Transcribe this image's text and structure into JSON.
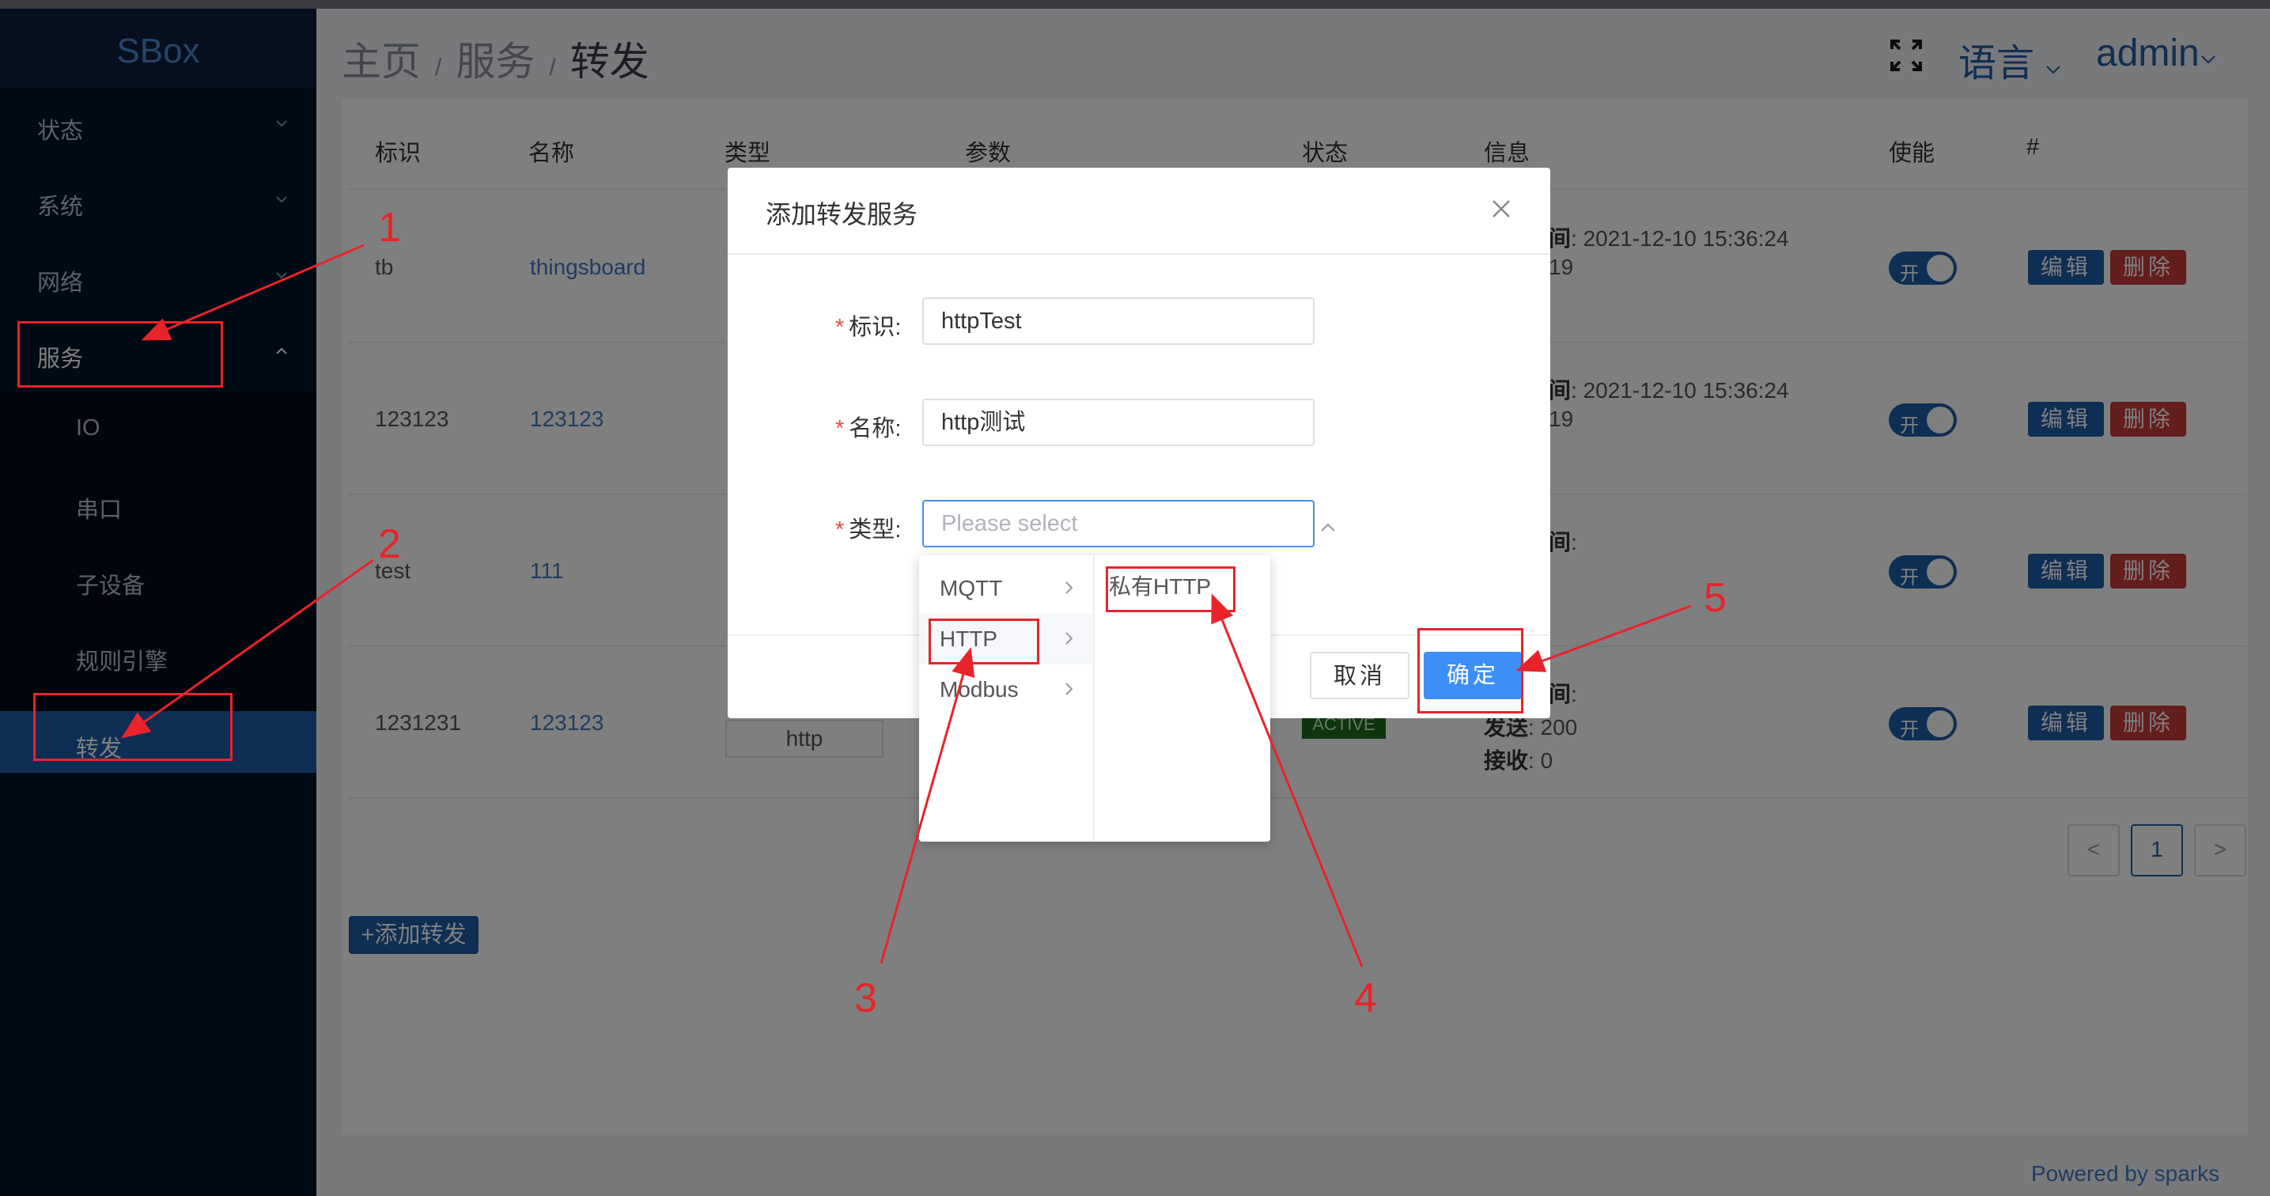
{
  "app": {
    "title": "SBox"
  },
  "sidebar": {
    "items": [
      {
        "label": "状态"
      },
      {
        "label": "系统"
      },
      {
        "label": "网络"
      },
      {
        "label": "服务"
      }
    ],
    "subitems": [
      {
        "label": "IO"
      },
      {
        "label": "串口"
      },
      {
        "label": "子设备"
      },
      {
        "label": "规则引擎"
      },
      {
        "label": "转发"
      }
    ]
  },
  "header": {
    "breadcrumb": [
      "主页",
      "服务",
      "转发"
    ],
    "breadcrumb_sep": "/",
    "language": "语言",
    "user": "admin"
  },
  "table": {
    "headers": [
      "标识",
      "名称",
      "类型",
      "参数",
      "状态",
      "信息",
      "使能",
      "#"
    ],
    "rows": [
      {
        "id": "tb",
        "name": "thingsboard",
        "info1_label": "间",
        "info1_value": ": 2021-12-10 15:36:24",
        "info2": "19",
        "switch": "开"
      },
      {
        "id": "123123",
        "name": "123123",
        "info1_label": "间",
        "info1_value": ": 2021-12-10 15:36:24",
        "info2": "19",
        "switch": "开"
      },
      {
        "id": "test",
        "name": "111",
        "info1_label": "间",
        "info1_value": ":",
        "switch": "开"
      },
      {
        "id": "1231231",
        "name": "123123",
        "type": "http",
        "status": "ACTIVE",
        "info1_label": "间",
        "info1_value": ":",
        "send_label": "发送",
        "send_value": ": 200",
        "recv_label": "接收",
        "recv_value": ": 0",
        "switch": "开"
      }
    ],
    "edit_label": "编辑",
    "delete_label": "删除"
  },
  "pagination": {
    "prev": "<",
    "current": "1",
    "next": ">"
  },
  "add_button": "+添加转发",
  "footer": "Powered by sparks",
  "modal": {
    "title": "添加转发服务",
    "fields": [
      {
        "label": "标识",
        "value": "httpTest"
      },
      {
        "label": "名称",
        "value": "http测试"
      },
      {
        "label": "类型",
        "placeholder": "Please select"
      }
    ],
    "cancel": "取消",
    "ok": "确定"
  },
  "cascader": {
    "level1": [
      "MQTT",
      "HTTP",
      "Modbus"
    ],
    "level2": [
      "私有HTTP"
    ]
  },
  "annotations": [
    "1",
    "2",
    "3",
    "4",
    "5"
  ],
  "colors": {
    "sidebar": "#001529",
    "primary": "#1f5da8",
    "danger": "#c83a3a",
    "annotation": "#e8242a"
  }
}
